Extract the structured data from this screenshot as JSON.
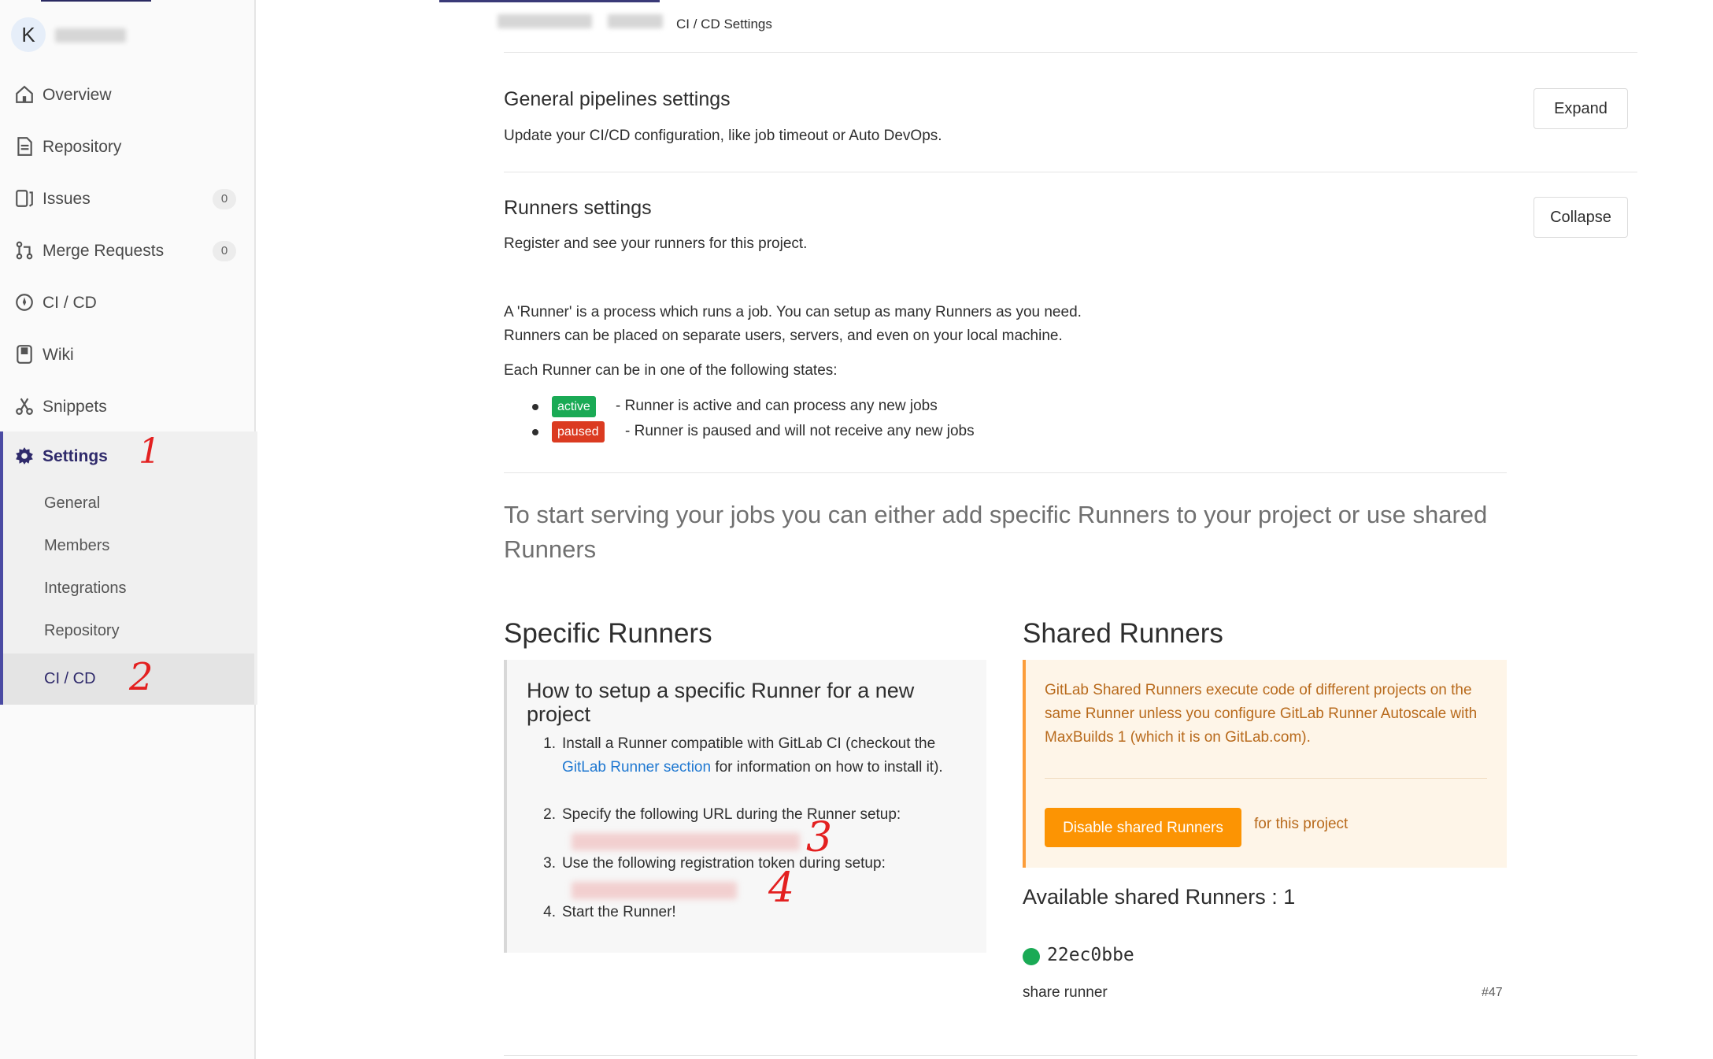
{
  "sidebar": {
    "avatar_letter": "K",
    "items": [
      {
        "label": "Overview",
        "icon": "home-icon"
      },
      {
        "label": "Repository",
        "icon": "document-icon"
      },
      {
        "label": "Issues",
        "icon": "issues-icon",
        "count": "0"
      },
      {
        "label": "Merge Requests",
        "icon": "merge-request-icon",
        "count": "0"
      },
      {
        "label": "CI / CD",
        "icon": "rocket-icon"
      },
      {
        "label": "Wiki",
        "icon": "book-icon"
      },
      {
        "label": "Snippets",
        "icon": "scissors-icon"
      }
    ],
    "settings": {
      "label": "Settings",
      "icon": "gear-icon",
      "subitems": [
        "General",
        "Members",
        "Integrations",
        "Repository",
        "CI / CD"
      ],
      "active": "CI / CD"
    },
    "annotations": [
      "1",
      "2"
    ]
  },
  "breadcrumb": {
    "current": "CI / CD Settings"
  },
  "general": {
    "title": "General pipelines settings",
    "description": "Update your CI/CD configuration, like job timeout or Auto DevOps.",
    "button": "Expand"
  },
  "runners": {
    "title": "Runners settings",
    "description": "Register and see your runners for this project.",
    "button": "Collapse",
    "intro_line1": "A 'Runner' is a process which runs a job. You can setup as many Runners as you need.",
    "intro_line2": "Runners can be placed on separate users, servers, and even on your local machine.",
    "states_intro": "Each Runner can be in one of the following states:",
    "states": [
      {
        "badge": "active",
        "text": "- Runner is active and can process any new jobs",
        "color": "#1aaa55"
      },
      {
        "badge": "paused",
        "text": "- Runner is paused and will not receive any new jobs",
        "color": "#db3b21"
      }
    ],
    "lead": "To start serving your jobs you can either add specific Runners to your project or use shared Runners"
  },
  "specific": {
    "heading": "Specific Runners",
    "box_title": "How to setup a specific Runner for a new project",
    "steps": [
      {
        "num": "1.",
        "pre": "Install a Runner compatible with GitLab CI (checkout the ",
        "link": "GitLab Runner section",
        "post": " for information on how to install it)."
      },
      {
        "num": "2.",
        "text": "Specify the following URL during the Runner setup:"
      },
      {
        "num": "3.",
        "text": "Use the following registration token during setup:"
      },
      {
        "num": "4.",
        "text": "Start the Runner!"
      }
    ],
    "annotations": [
      "3",
      "4"
    ]
  },
  "shared": {
    "heading": "Shared Runners",
    "notice": "GitLab Shared Runners execute code of different projects on the same Runner unless you configure GitLab Runner Autoscale with MaxBuilds 1 (which it is on GitLab.com).",
    "button": "Disable shared Runners",
    "button_suffix": "for this project",
    "available": "Available shared Runners : 1",
    "runner": {
      "id": "22ec0bbe",
      "description": "share runner",
      "number": "#47",
      "status_color": "#1aaa55"
    }
  }
}
